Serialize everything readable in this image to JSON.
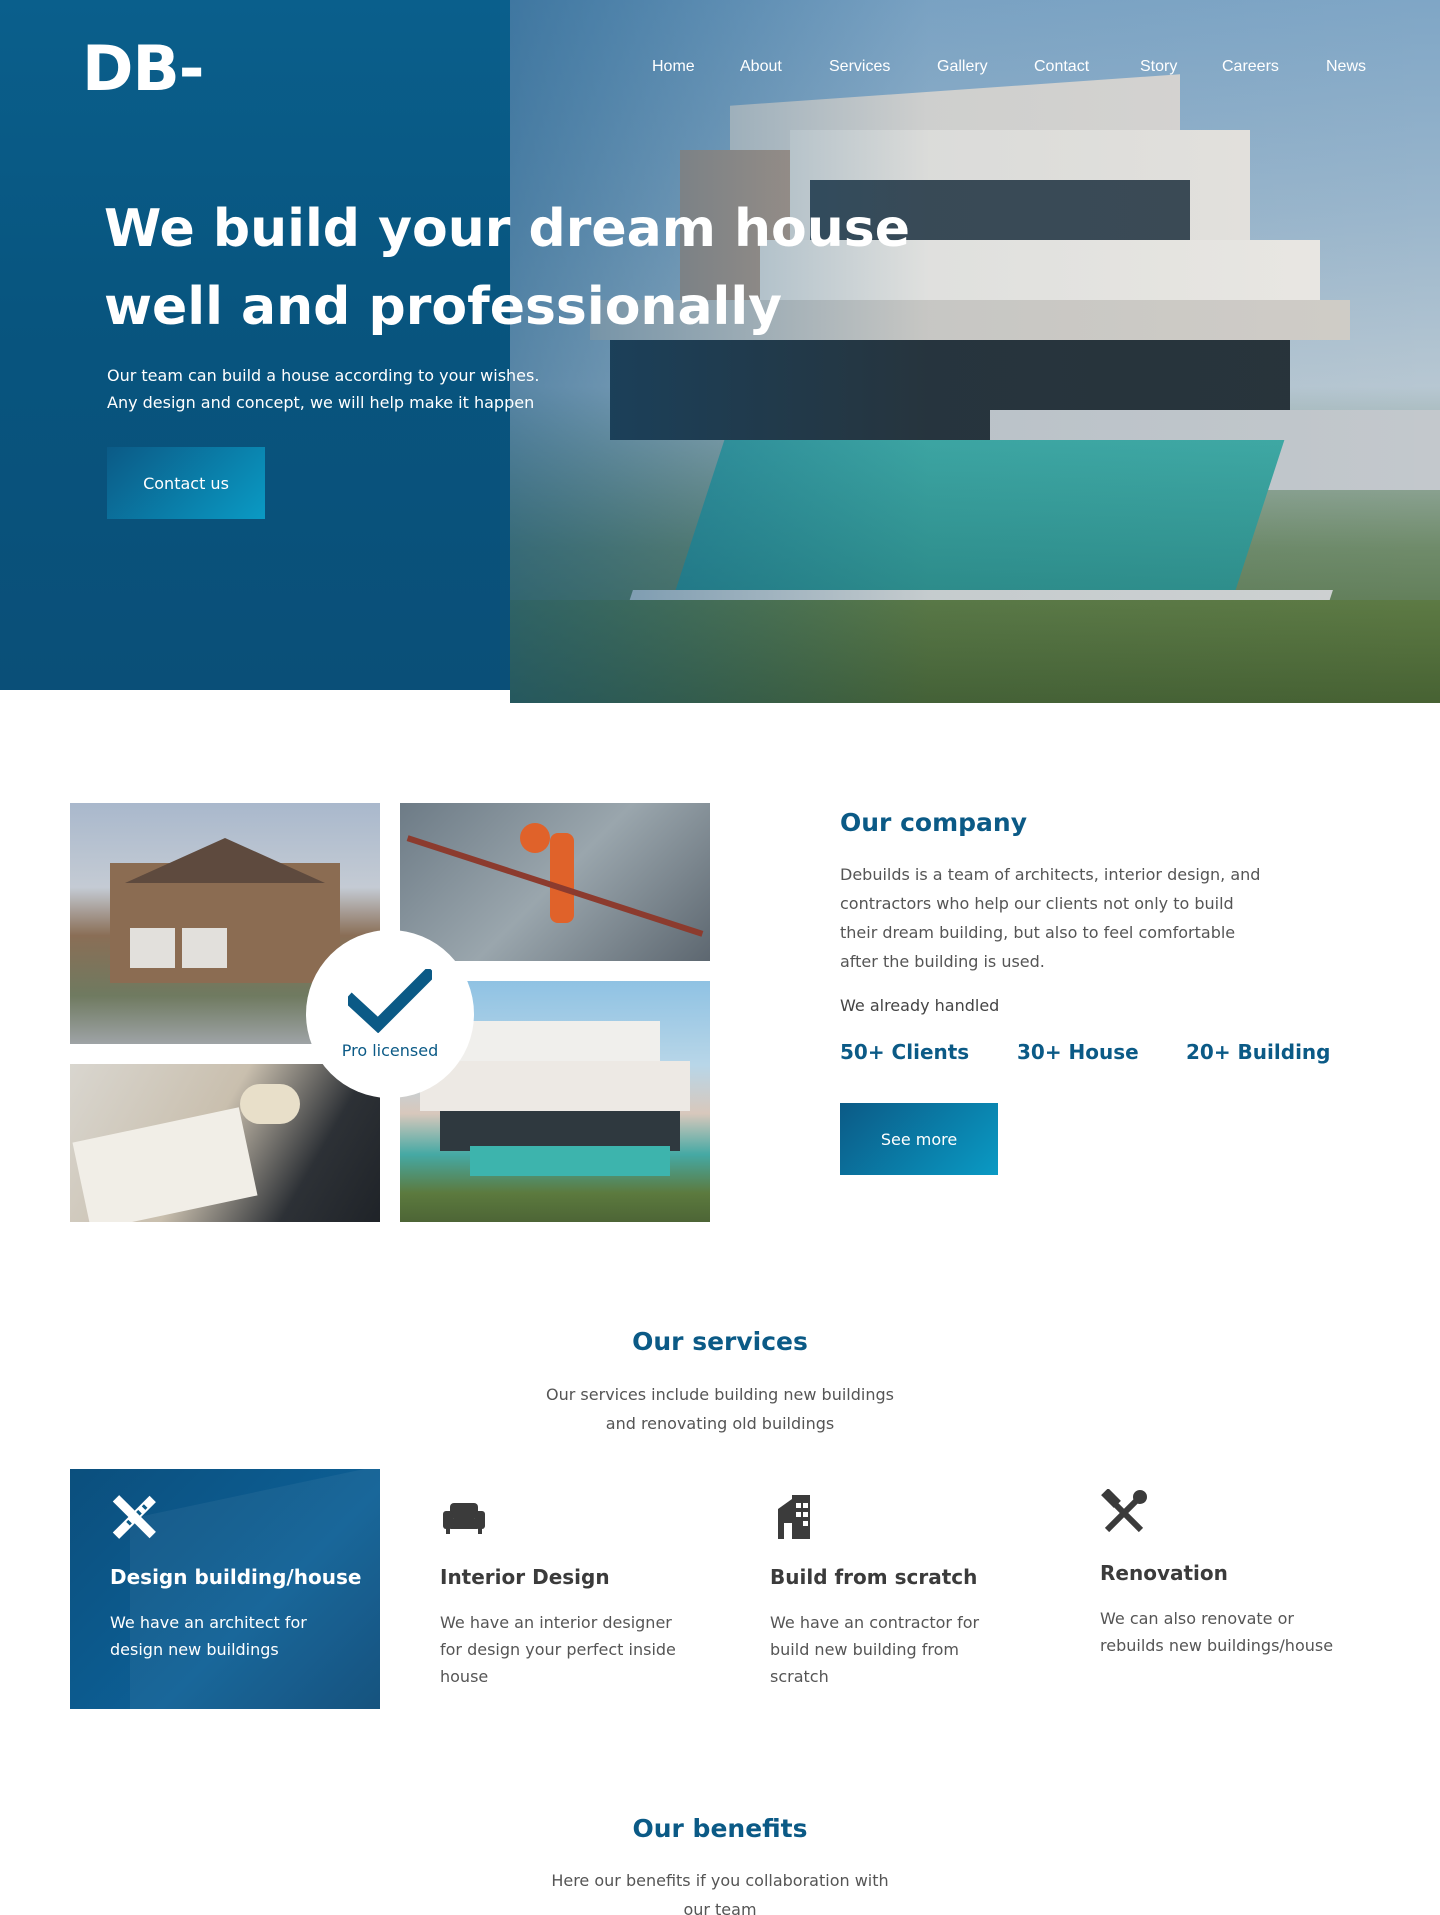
{
  "brand": {
    "logo": "DB-"
  },
  "nav": {
    "items": [
      {
        "label": "Home"
      },
      {
        "label": "About"
      },
      {
        "label": "Services"
      },
      {
        "label": "Gallery"
      },
      {
        "label": "Contact"
      },
      {
        "label": "Story"
      },
      {
        "label": "Careers"
      },
      {
        "label": "News"
      }
    ]
  },
  "hero": {
    "title_line1": "We build your dream house",
    "title_line2": "well and professionally",
    "subtitle_line1": "Our team can build a house according to your wishes.",
    "subtitle_line2": "Any design and concept, we will help make it happen",
    "cta_label": "Contact us"
  },
  "company": {
    "badge_label": "Pro licensed",
    "title": "Our company",
    "description": "Debuilds is a team of architects, interior design, and contractors who help our clients not only to build their dream building, but also to feel comfortable after the building is used.",
    "handled_label": "We already handled",
    "stats": [
      {
        "label": "50+ Clients"
      },
      {
        "label": "30+ House"
      },
      {
        "label": "20+ Building"
      }
    ],
    "see_more_label": "See more"
  },
  "services": {
    "title": "Our services",
    "subtitle_line1": "Our services include building new buildings",
    "subtitle_line2": "and renovating old buildings",
    "items": [
      {
        "icon": "ruler-pencil-icon",
        "title": "Design building/house",
        "text": "We have an architect for design new buildings",
        "active": true
      },
      {
        "icon": "sofa-icon",
        "title": "Interior Design",
        "text": "We have an interior designer for design your perfect inside house",
        "active": false
      },
      {
        "icon": "building-icon",
        "title": "Build from scratch",
        "text": "We have an contractor for build new building from scratch",
        "active": false
      },
      {
        "icon": "hammer-wrench-icon",
        "title": "Renovation",
        "text": "We can also renovate or rebuilds new buildings/house",
        "active": false
      }
    ]
  },
  "benefits": {
    "title": "Our benefits",
    "subtitle_line1": "Here our benefits if you collaboration with",
    "subtitle_line2": "our team"
  },
  "colors": {
    "primary": "#0b5a86",
    "accent": "#0a9ac4",
    "text": "#555555",
    "heading_dark": "#3b3b3b"
  }
}
